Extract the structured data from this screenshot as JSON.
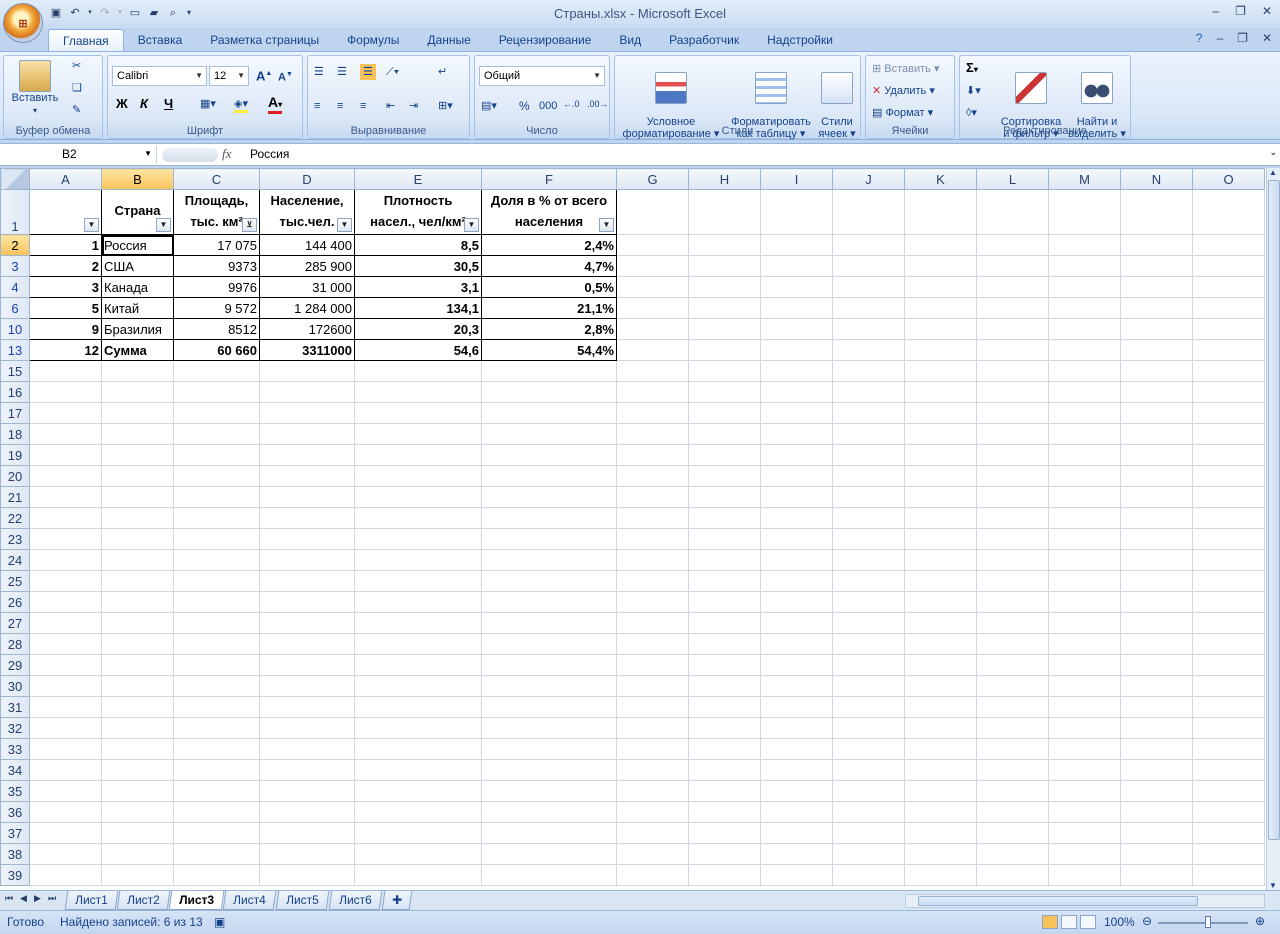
{
  "window": {
    "title": "Страны.xlsx - Microsoft Excel"
  },
  "ribbon_tabs": [
    "Главная",
    "Вставка",
    "Разметка страницы",
    "Формулы",
    "Данные",
    "Рецензирование",
    "Вид",
    "Разработчик",
    "Надстройки"
  ],
  "ribbon": {
    "clipboard": {
      "label": "Буфер обмена",
      "paste": "Вставить"
    },
    "font": {
      "label": "Шрифт",
      "name": "Calibri",
      "size": "12",
      "bold": "Ж",
      "italic": "К",
      "underline": "Ч"
    },
    "alignment": {
      "label": "Выравнивание"
    },
    "number": {
      "label": "Число",
      "format": "Общий",
      "percent": "%",
      "thousands": "000"
    },
    "styles": {
      "label": "Стили",
      "conditional": "Условное\nформатирование",
      "format_table": "Форматировать\nкак таблицу",
      "cell_styles": "Стили\nячеек"
    },
    "cells": {
      "label": "Ячейки",
      "insert": "Вставить",
      "delete": "Удалить",
      "format": "Формат"
    },
    "editing": {
      "label": "Редактирование",
      "sort": "Сортировка\nи фильтр",
      "find": "Найти и\nвыделить"
    }
  },
  "formula_bar": {
    "name_box": "B2",
    "fx": "fx",
    "value": "Россия"
  },
  "columns": [
    "A",
    "B",
    "C",
    "D",
    "E",
    "F",
    "G",
    "H",
    "I",
    "J",
    "K",
    "L",
    "M",
    "N",
    "O"
  ],
  "table": {
    "headers": {
      "A": [
        "",
        ""
      ],
      "B": [
        "Страна",
        ""
      ],
      "C": [
        "Площадь,",
        "тыс. км²"
      ],
      "D": [
        "Население,",
        "тыс.чел."
      ],
      "E": [
        "Плотность",
        "насел., чел/км²"
      ],
      "F": [
        "Доля в % от всего",
        "населения"
      ]
    },
    "rows": [
      {
        "row": "2",
        "A": "1",
        "B": "Россия",
        "C": "17 075",
        "D": "144 400",
        "E": "8,5",
        "F": "2,4%"
      },
      {
        "row": "3",
        "A": "2",
        "B": "США",
        "C": "9373",
        "D": "285 900",
        "E": "30,5",
        "F": "4,7%"
      },
      {
        "row": "4",
        "A": "3",
        "B": "Канада",
        "C": "9976",
        "D": "31 000",
        "E": "3,1",
        "F": "0,5%"
      },
      {
        "row": "6",
        "A": "5",
        "B": "Китай",
        "C": "9 572",
        "D": "1 284 000",
        "E": "134,1",
        "F": "21,1%"
      },
      {
        "row": "10",
        "A": "9",
        "B": "Бразилия",
        "C": "8512",
        "D": "172600",
        "E": "20,3",
        "F": "2,8%"
      },
      {
        "row": "13",
        "A": "12",
        "B": "Сумма",
        "C": "60 660",
        "D": "3311000",
        "E": "54,6",
        "F": "54,4%"
      }
    ],
    "empty_rows": [
      "15",
      "16",
      "17",
      "18",
      "19",
      "20",
      "21",
      "22",
      "23",
      "24",
      "25",
      "26",
      "27",
      "28",
      "29",
      "30",
      "31",
      "32",
      "33",
      "34",
      "35",
      "36",
      "37",
      "38",
      "39"
    ]
  },
  "sheets": [
    "Лист1",
    "Лист2",
    "Лист3",
    "Лист4",
    "Лист5",
    "Лист6"
  ],
  "active_sheet": "Лист3",
  "status": {
    "ready": "Готово",
    "found": "Найдено записей: 6 из 13",
    "zoom": "100%"
  }
}
